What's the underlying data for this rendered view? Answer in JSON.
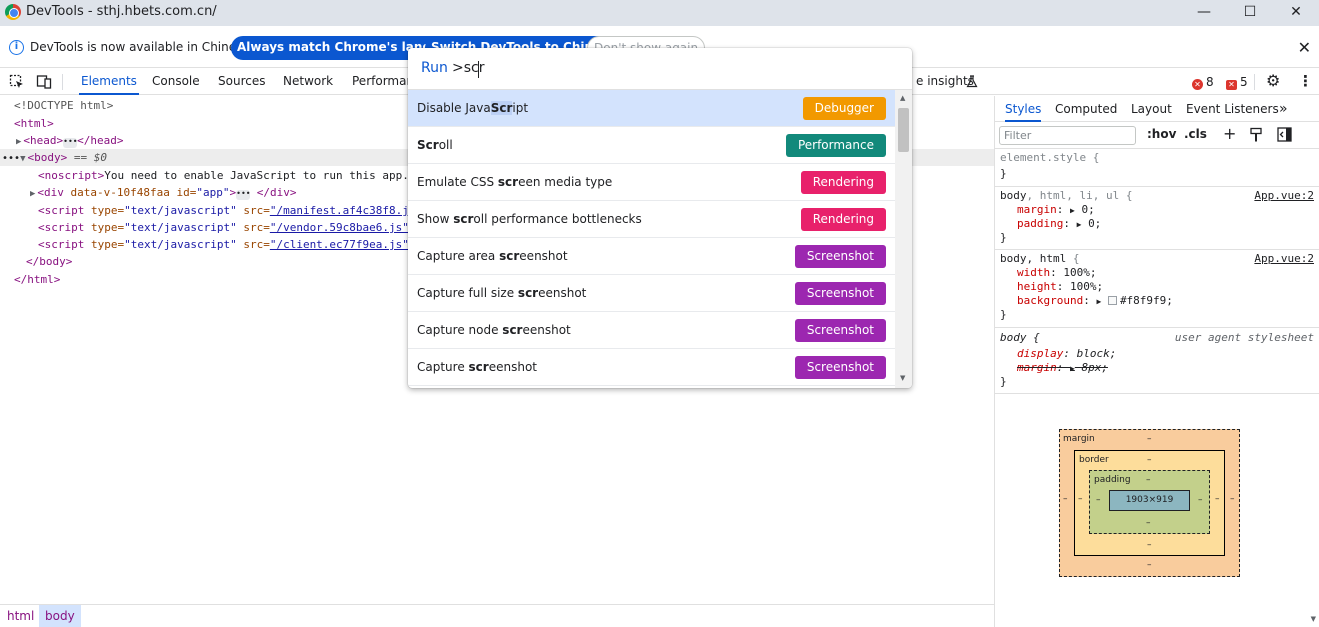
{
  "window": {
    "title": "DevTools - sthj.hbets.com.cn/",
    "minimize": "—",
    "maximize": "☐",
    "close": "✕"
  },
  "infobar": {
    "message": "DevTools is now available in Chinese!",
    "btn_match": "Always match Chrome's language",
    "btn_switch": "Switch DevTools to Chinese",
    "btn_dont_show": "Don't show again",
    "close": "✕"
  },
  "toolbar": {
    "tabs": [
      "Elements",
      "Console",
      "Sources",
      "Network",
      "Performance",
      "e insights"
    ],
    "error_count": "8",
    "warning_count": "5",
    "more": "⋮",
    "settings": "⚙"
  },
  "dom": {
    "doctype": "<!DOCTYPE html>",
    "html_open": "<html>",
    "head": [
      "<head>",
      "</head>"
    ],
    "body_open": "<body>",
    "body_eq": "== $0",
    "noscript_tag": "<noscript>",
    "noscript_text": "You need to enable JavaScript to run this app.",
    "div": {
      "open": "<div ",
      "attr1": "data-v-10f48faa",
      "attr2": " id=",
      "val": "\"app\"",
      "close_open": ">",
      "close": "</div>"
    },
    "scripts": [
      {
        "pre": "<script ",
        "type_attr": "type=",
        "type_val": "\"text/javascript\"",
        "src_attr": " src=",
        "src_val": "\"/manifest.af4c38f8.j"
      },
      {
        "pre": "<script ",
        "type_attr": "type=",
        "type_val": "\"text/javascript\"",
        "src_attr": " src=",
        "src_val": "\"/vendor.59c8bae6.js\""
      },
      {
        "pre": "<script ",
        "type_attr": "type=",
        "type_val": "\"text/javascript\"",
        "src_attr": " src=",
        "src_val": "\"/client.ec77f9ea.js\""
      }
    ],
    "body_close": "</body>",
    "html_close": "</html>"
  },
  "breadcrumb": [
    "html",
    "body"
  ],
  "styles": {
    "tabs": [
      "Styles",
      "Computed",
      "Layout",
      "Event Listeners"
    ],
    "filter_placeholder": "Filter",
    "hov": ":hov",
    "cls": ".cls",
    "rules": [
      {
        "selector": "element.style {",
        "close": "}"
      },
      {
        "selector_main": "body",
        "selector_rest": ", html, li, ul {",
        "source": "App.vue:2",
        "props": [
          {
            "name": "margin",
            "value": "0;"
          },
          {
            "name": "padding",
            "value": "0;"
          }
        ],
        "close": "}"
      },
      {
        "selector_main": "body, html",
        "selector_rest": " {",
        "source": "App.vue:2",
        "props": [
          {
            "name": "width",
            "value": "100%;"
          },
          {
            "name": "height",
            "value": "100%;"
          },
          {
            "name": "background",
            "value": "#f8f9f9;"
          }
        ],
        "close": "}"
      },
      {
        "selector": "body {",
        "source": "user agent stylesheet",
        "props": [
          {
            "name": "display",
            "value": "block;"
          },
          {
            "name": "margin",
            "value": "8px;"
          }
        ],
        "close": "}"
      }
    ],
    "box_model": {
      "margin_label": "margin",
      "border_label": "border",
      "padding_label": "padding",
      "content": "1903×919",
      "dash": "–"
    }
  },
  "command_menu": {
    "prefix": "Run",
    "query": ">scr",
    "items": [
      {
        "pre": "Disable Java",
        "match": "Scr",
        "post": "ipt",
        "badge": "Debugger",
        "color": "#f29900",
        "highlight": true
      },
      {
        "pre": "",
        "match": "Scr",
        "post": "oll",
        "badge": "Performance",
        "color": "#12897b"
      },
      {
        "pre": "Emulate CSS ",
        "match": "scr",
        "post": "een media type",
        "badge": "Rendering",
        "color": "#e8216b"
      },
      {
        "pre": "Show ",
        "match": "scr",
        "post": "oll performance bottlenecks",
        "badge": "Rendering",
        "color": "#e8216b"
      },
      {
        "pre": "Capture area ",
        "match": "scr",
        "post": "eenshot",
        "badge": "Screenshot",
        "color": "#9c27b0"
      },
      {
        "pre": "Capture full size ",
        "match": "scr",
        "post": "eenshot",
        "badge": "Screenshot",
        "color": "#9c27b0"
      },
      {
        "pre": "Capture node ",
        "match": "scr",
        "post": "eenshot",
        "badge": "Screenshot",
        "color": "#9c27b0"
      },
      {
        "pre": "Capture ",
        "match": "scr",
        "post": "eenshot",
        "badge": "Screenshot",
        "color": "#9c27b0"
      }
    ]
  }
}
